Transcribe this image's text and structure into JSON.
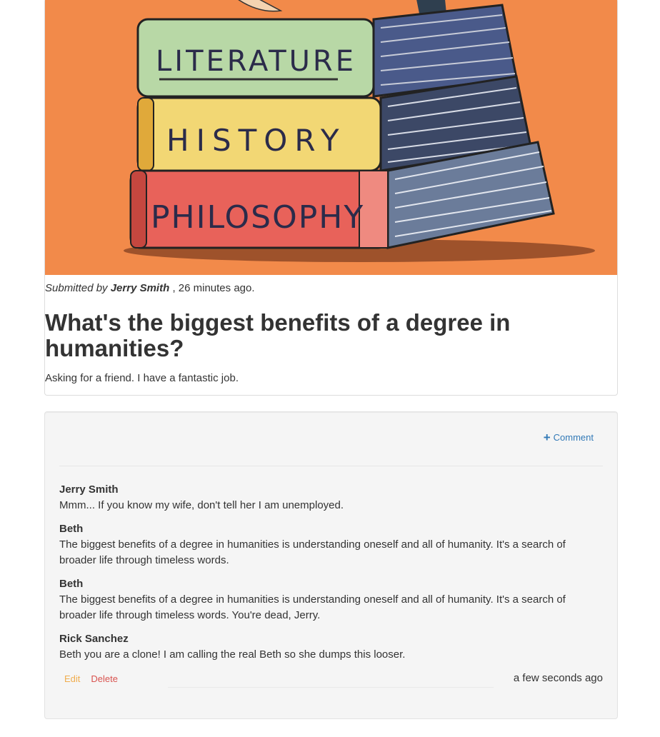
{
  "post": {
    "image_alt": "Stack of books on orange background",
    "book_labels": [
      "LITERATURE",
      "HISTORY",
      "PHILOSOPHY"
    ],
    "submitted_prefix": "Submitted by",
    "author": "Jerry Smith",
    "time": ", 26 minutes ago.",
    "title": "What's the biggest benefits of a degree in humanities?",
    "body": "Asking for a friend. I have a fantastic job."
  },
  "comments_panel": {
    "comment_button_label": "Comment",
    "comments": [
      {
        "author": "Jerry Smith",
        "text": "Mmm... If you know my wife, don't tell her I am unemployed."
      },
      {
        "author": "Beth",
        "text": "The biggest benefits of a degree in humanities is understanding oneself and all of humanity. It's a search of broader life through timeless words."
      },
      {
        "author": "Beth",
        "text": "The biggest benefits of a degree in humanities is understanding oneself and all of humanity. It's a search of broader life through timeless words. You're dead, Jerry."
      },
      {
        "author": "Rick Sanchez",
        "text": "Beth you are a clone! I am calling the real Beth so she dumps this looser."
      }
    ],
    "edit_label": "Edit",
    "delete_label": "Delete",
    "timestamp": "a few seconds ago"
  },
  "colors": {
    "image_background": "#f28a4a",
    "link": "#337ab7",
    "edit": "#f0ad4e",
    "delete": "#d9534f"
  }
}
